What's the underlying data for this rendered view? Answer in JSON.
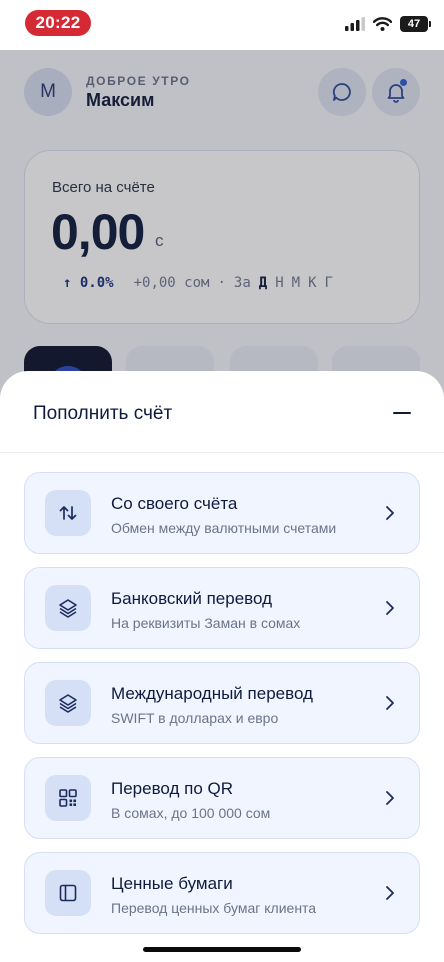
{
  "status_bar": {
    "time": "20:22",
    "battery": "47",
    "icons": [
      "signal-icon",
      "wifi-icon",
      "battery-icon"
    ]
  },
  "header": {
    "avatar_letter": "М",
    "greeting": "ДОБРОЕ УТРО",
    "username": "Максим",
    "icons": [
      "chat-icon",
      "bell-icon"
    ]
  },
  "balance": {
    "label": "Всего на счёте",
    "amount": "0,00",
    "currency": "с",
    "change": "0.0%",
    "change_sum": "+0,00 сом",
    "separator": "·",
    "period_label": "За",
    "periods": [
      "Д",
      "Н",
      "М",
      "К",
      "Г"
    ],
    "active_period": "Д"
  },
  "sheet": {
    "title": "Пополнить счёт",
    "options": [
      {
        "title": "Со своего счёта",
        "subtitle": "Обмен между валютными счетами",
        "icon": "transfer-arrows-icon"
      },
      {
        "title": "Банковский перевод",
        "subtitle": "На реквизиты Заман в сомах",
        "icon": "layers-icon"
      },
      {
        "title": "Международный перевод",
        "subtitle": "SWIFT в долларах и евро",
        "icon": "layers-icon"
      },
      {
        "title": "Перевод по QR",
        "subtitle": "В сомах, до 100 000 сом",
        "icon": "qr-icon"
      },
      {
        "title": "Ценные бумаги",
        "subtitle": "Перевод ценных бумаг клиента",
        "icon": "panel-icon"
      }
    ]
  },
  "colors": {
    "accent": "#0f1b3d",
    "time_pill": "#d52a33",
    "option_bg": "#f1f5ff",
    "icon_bg": "#d5e0f7"
  }
}
